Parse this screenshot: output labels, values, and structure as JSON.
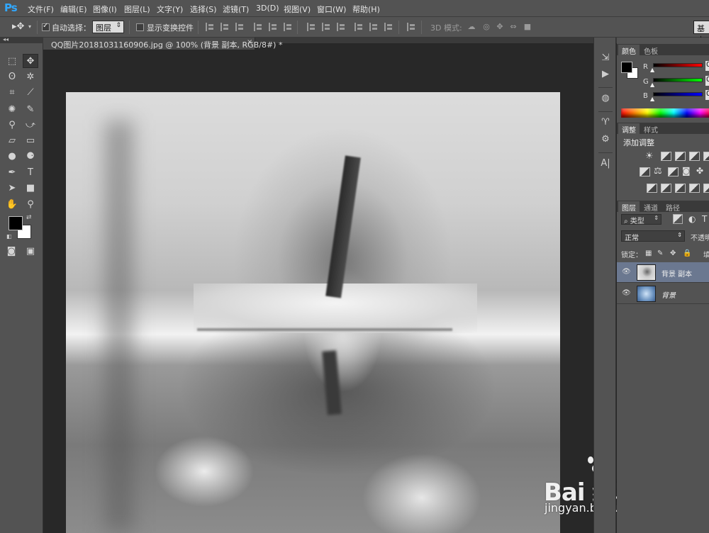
{
  "app": {
    "logo": "Ps"
  },
  "menubar": {
    "items": [
      "文件(F)",
      "编辑(E)",
      "图像(I)",
      "图层(L)",
      "文字(Y)",
      "选择(S)",
      "滤镜(T)",
      "3D(D)",
      "视图(V)",
      "窗口(W)",
      "帮助(H)"
    ]
  },
  "options": {
    "tool_icon": "move-tool-icon",
    "auto_select_label": "自动选择：",
    "auto_select_checked": true,
    "auto_select_value": "图层",
    "show_transform_label": "显示变换控件",
    "show_transform_checked": false,
    "mode_3d_label": "3D 模式:",
    "workspace_label": "基本"
  },
  "document": {
    "tab_title": "QQ图片20181031160906.jpg @ 100% (背景 副本, RGB/8#) *",
    "close_glyph": "×"
  },
  "tools": [
    {
      "name": "marquee-tool",
      "glyph": "⬚"
    },
    {
      "name": "move-tool",
      "glyph": "▸✥",
      "active": true
    },
    {
      "name": "lasso-tool",
      "glyph": "ʘ"
    },
    {
      "name": "magic-wand-tool",
      "glyph": "✲"
    },
    {
      "name": "crop-tool",
      "glyph": "⌗"
    },
    {
      "name": "eyedropper-tool",
      "glyph": "⟋"
    },
    {
      "name": "healing-brush-tool",
      "glyph": "✺"
    },
    {
      "name": "brush-tool",
      "glyph": "✎"
    },
    {
      "name": "clone-stamp-tool",
      "glyph": "⚲"
    },
    {
      "name": "history-brush-tool",
      "glyph": "⤻"
    },
    {
      "name": "eraser-tool",
      "glyph": "▱"
    },
    {
      "name": "gradient-tool",
      "glyph": "▭"
    },
    {
      "name": "blur-tool",
      "glyph": "●"
    },
    {
      "name": "dodge-tool",
      "glyph": "⚈"
    },
    {
      "name": "pen-tool",
      "glyph": "✒"
    },
    {
      "name": "type-tool",
      "glyph": "T"
    },
    {
      "name": "path-selection-tool",
      "glyph": "➤"
    },
    {
      "name": "rectangle-tool",
      "glyph": "■"
    },
    {
      "name": "hand-tool",
      "glyph": "✋"
    },
    {
      "name": "zoom-tool",
      "glyph": "⚲"
    }
  ],
  "colors": {
    "foreground": "#000000",
    "background": "#ffffff"
  },
  "panels": {
    "color_tabs": [
      "颜色",
      "色板"
    ],
    "channels": [
      {
        "label": "R",
        "value": "0",
        "gradient": "#ff0000"
      },
      {
        "label": "G",
        "value": "0",
        "gradient": "#00ff00"
      },
      {
        "label": "B",
        "value": "0",
        "gradient": "#0000ff"
      }
    ],
    "adjust_tabs": [
      "调整",
      "样式"
    ],
    "adjust_title": "添加调整",
    "layers_tabs": [
      "图层",
      "通道",
      "路径"
    ],
    "filter_kind": "类型",
    "blend_mode": "正常",
    "opacity_label": "不透明",
    "lock_label": "锁定：",
    "fill_label": "填",
    "layers": [
      {
        "name": "背景 副本",
        "selected": true
      },
      {
        "name": "背景",
        "selected": false
      }
    ]
  },
  "watermark": {
    "logo_text": "Bai 经验",
    "url": "jingyan.baidu.com"
  }
}
